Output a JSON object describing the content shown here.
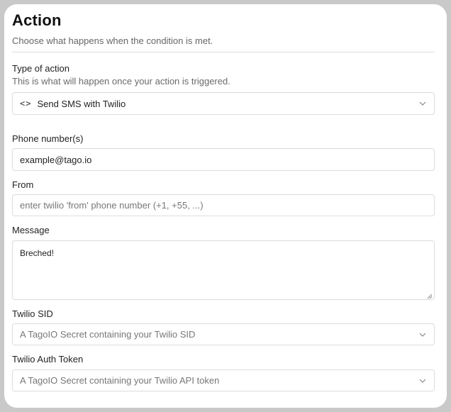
{
  "header": {
    "title": "Action",
    "subtitle": "Choose what happens when the condition is met."
  },
  "type_of_action": {
    "label": "Type of action",
    "hint": "This is what will happen once your action is triggered.",
    "value": "Send SMS with Twilio",
    "icon": "code-icon"
  },
  "phone_numbers": {
    "label": "Phone number(s)",
    "value": "example@tago.io"
  },
  "from": {
    "label": "From",
    "placeholder": "enter twilio 'from' phone number (+1, +55, ...)"
  },
  "message": {
    "label": "Message",
    "value": "Breched!"
  },
  "twilio_sid": {
    "label": "Twilio SID",
    "placeholder": "A TagoIO Secret containing your Twilio SID"
  },
  "twilio_auth_token": {
    "label": "Twilio Auth Token",
    "placeholder": "A TagoIO Secret containing your Twilio API token"
  },
  "colors": {
    "frame_background": "#c9c9c9",
    "panel_background": "#ffffff",
    "border": "#dcdcdc",
    "muted_text": "#666666"
  }
}
